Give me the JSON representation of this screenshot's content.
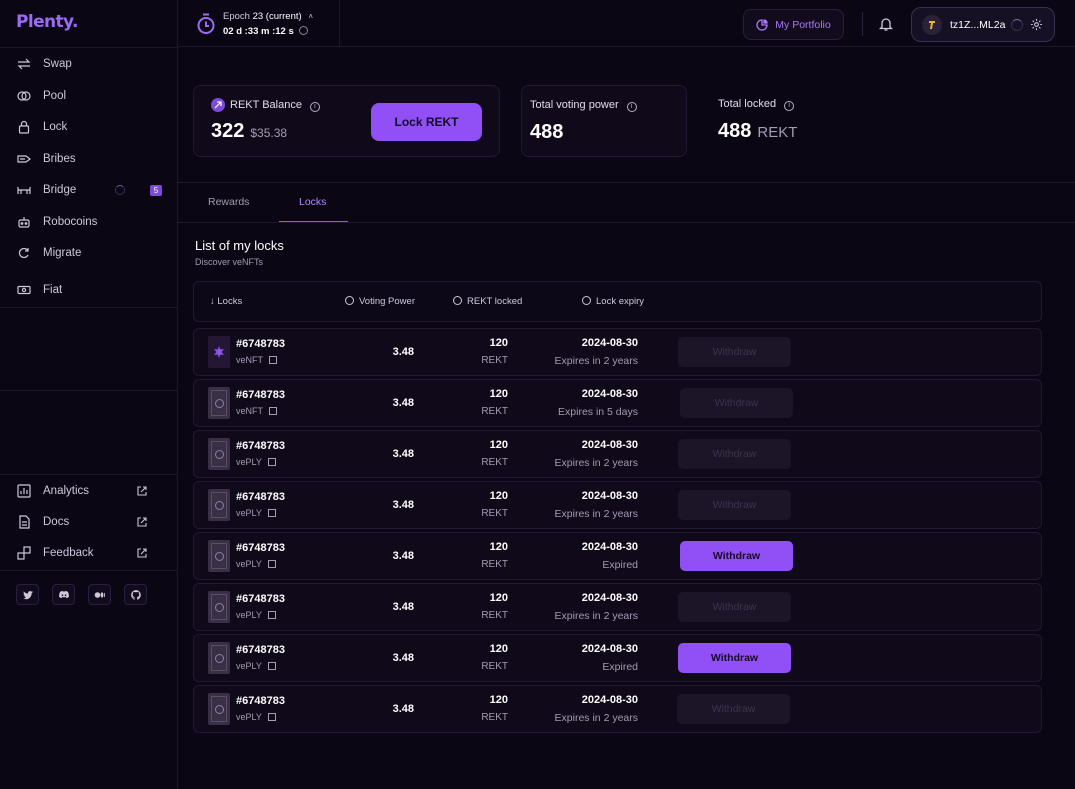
{
  "brand": {
    "logo": "Plenty."
  },
  "sidebar": {
    "items": [
      {
        "label": "Swap",
        "icon": "swap-icon"
      },
      {
        "label": "Pool",
        "icon": "pool-icon"
      },
      {
        "label": "Lock",
        "icon": "lock-icon"
      },
      {
        "label": "Bribes",
        "icon": "bribes-icon"
      },
      {
        "label": "Bridge",
        "icon": "bridge-icon",
        "badge": "5"
      },
      {
        "label": "Robocoins",
        "icon": "robot-icon"
      },
      {
        "label": "Migrate",
        "icon": "migrate-icon"
      },
      {
        "label": "Fiat",
        "icon": "fiat-icon"
      }
    ],
    "links": [
      {
        "label": "Analytics",
        "icon": "analytics-icon"
      },
      {
        "label": "Docs",
        "icon": "docs-icon"
      },
      {
        "label": "Feedback",
        "icon": "feedback-icon"
      }
    ],
    "socials": [
      "twitter-icon",
      "discord-icon",
      "medium-icon",
      "github-icon"
    ]
  },
  "topbar": {
    "epoch_label": "Epoch",
    "epoch_number": "23 (current)",
    "countdown": "02 d  :33 m  :12 s",
    "portfolio_label": "My Portfolio",
    "wallet_address": "tz1Z...ML2a"
  },
  "stats": {
    "balance_label": "REKT Balance",
    "balance_value": "322",
    "balance_usd": "$35.38",
    "lock_button": "Lock REKT",
    "voting_power_label": "Total voting power",
    "voting_power_value": "488",
    "total_locked_label": "Total locked",
    "total_locked_value": "488",
    "total_locked_unit": "REKT"
  },
  "tabs": [
    {
      "label": "Rewards",
      "active": false
    },
    {
      "label": "Locks",
      "active": true
    }
  ],
  "locks": {
    "title": "List of my locks",
    "subtitle": "Discover veNFTs",
    "columns": {
      "locks": "Locks",
      "voting_power": "Voting Power",
      "rekt_locked": "REKT locked",
      "lock_expiry": "Lock expiry"
    },
    "withdraw_label": "Withdraw",
    "rows": [
      {
        "id": "#6748783",
        "type": "veNFT",
        "voting_power": "3.48",
        "amount": "120",
        "unit": "REKT",
        "expiry_date": "2024-08-30",
        "status": "Expires in 2 years",
        "withdraw_enabled": false
      },
      {
        "id": "#6748783",
        "type": "veNFT",
        "voting_power": "3.48",
        "amount": "120",
        "unit": "REKT",
        "expiry_date": "2024-08-30",
        "status": "Expires in 5 days",
        "withdraw_enabled": false
      },
      {
        "id": "#6748783",
        "type": "vePLY",
        "voting_power": "3.48",
        "amount": "120",
        "unit": "REKT",
        "expiry_date": "2024-08-30",
        "status": "Expires in 2 years",
        "withdraw_enabled": false
      },
      {
        "id": "#6748783",
        "type": "vePLY",
        "voting_power": "3.48",
        "amount": "120",
        "unit": "REKT",
        "expiry_date": "2024-08-30",
        "status": "Expires in 2 years",
        "withdraw_enabled": false
      },
      {
        "id": "#6748783",
        "type": "vePLY",
        "voting_power": "3.48",
        "amount": "120",
        "unit": "REKT",
        "expiry_date": "2024-08-30",
        "status": "Expired",
        "withdraw_enabled": true
      },
      {
        "id": "#6748783",
        "type": "vePLY",
        "voting_power": "3.48",
        "amount": "120",
        "unit": "REKT",
        "expiry_date": "2024-08-30",
        "status": "Expires in 2 years",
        "withdraw_enabled": false
      },
      {
        "id": "#6748783",
        "type": "vePLY",
        "voting_power": "3.48",
        "amount": "120",
        "unit": "REKT",
        "expiry_date": "2024-08-30",
        "status": "Expired",
        "withdraw_enabled": true
      },
      {
        "id": "#6748783",
        "type": "vePLY",
        "voting_power": "3.48",
        "amount": "120",
        "unit": "REKT",
        "expiry_date": "2024-08-30",
        "status": "Expires in 2 years",
        "withdraw_enabled": false
      }
    ]
  },
  "colors": {
    "accent": "#9150f5",
    "background": "#0b0613",
    "border": "#221836"
  }
}
